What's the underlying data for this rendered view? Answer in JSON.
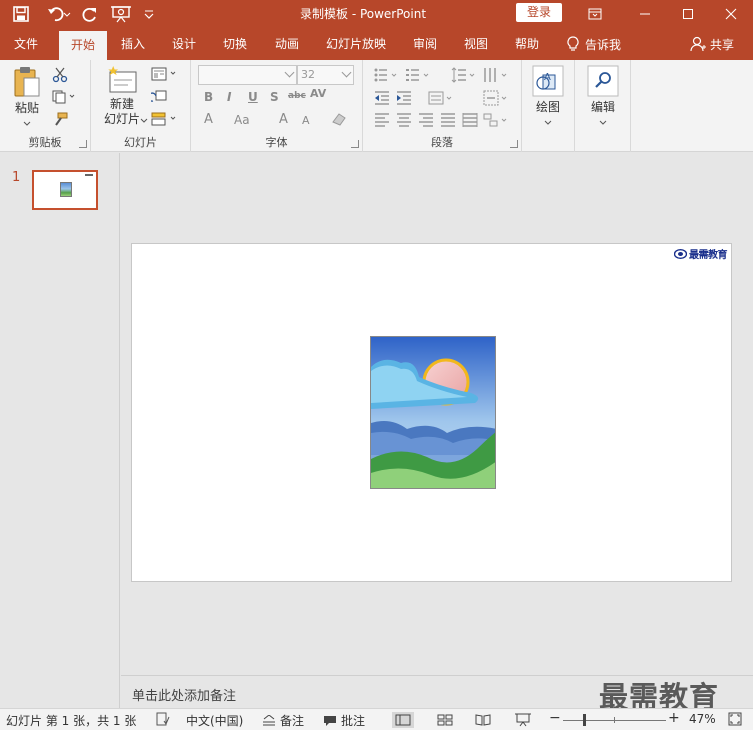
{
  "titlebar": {
    "document_title": "录制模板  -  PowerPoint",
    "login_label": "登录"
  },
  "tabs": [
    {
      "label": "文件",
      "active": false
    },
    {
      "label": "开始",
      "active": true
    },
    {
      "label": "插入",
      "active": false
    },
    {
      "label": "设计",
      "active": false
    },
    {
      "label": "切换",
      "active": false
    },
    {
      "label": "动画",
      "active": false
    },
    {
      "label": "幻灯片放映",
      "active": false
    },
    {
      "label": "审阅",
      "active": false
    },
    {
      "label": "视图",
      "active": false
    },
    {
      "label": "帮助",
      "active": false
    }
  ],
  "tell_me": "告诉我",
  "share": "共享",
  "ribbon": {
    "clipboard": {
      "group_label": "剪贴板",
      "paste_label": "粘贴"
    },
    "slides": {
      "group_label": "幻灯片",
      "new_slide_line1": "新建",
      "new_slide_line2": "幻灯片"
    },
    "font": {
      "group_label": "字体",
      "font_name": "",
      "font_size": "32"
    },
    "paragraph": {
      "group_label": "段落"
    },
    "drawing": {
      "label": "绘图"
    },
    "editing": {
      "label": "编辑"
    }
  },
  "thumbnails": {
    "slide_number": "1"
  },
  "slide": {
    "logo_text": "最需教育"
  },
  "notes": {
    "placeholder": "单击此处添加备注",
    "watermark": "最需教育"
  },
  "status": {
    "slide_info": "幻灯片 第 1 张，共 1 张",
    "language": "中文(中国)",
    "notes_label": "备注",
    "comments_label": "批注",
    "zoom_minus": "−",
    "zoom_plus": "+",
    "zoom_level": "47%"
  },
  "colors": {
    "accent": "#b7472a",
    "ribbon_bg": "#f3f3f3",
    "workspace_bg": "#e6e6e6"
  }
}
